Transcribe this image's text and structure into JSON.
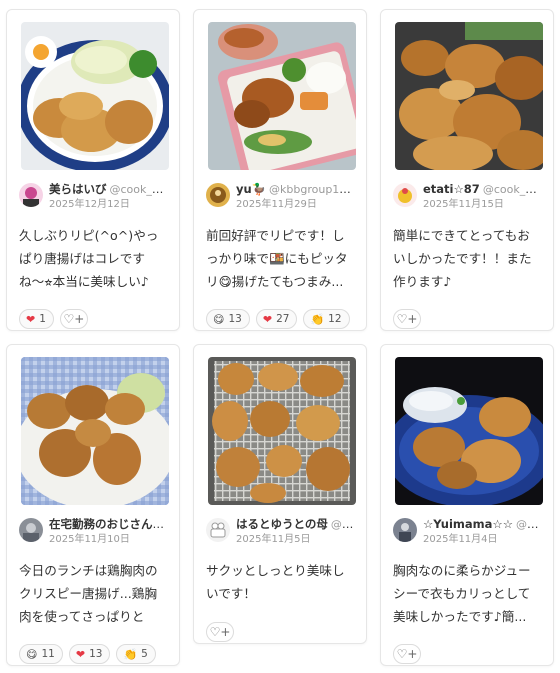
{
  "cards": [
    {
      "author_name": "美らはいび",
      "author_handle": "@cook_4...",
      "date": "2025年12月12日",
      "comment": "久しぶりリピ(^o^)やっぱり唐揚げはコレですね〜⭐︎本当に美味しい♪",
      "reactions": [
        {
          "icon": "heart-icon",
          "glyph": "❤",
          "count": "1"
        }
      ],
      "add_reaction_icon": "add-reaction-icon"
    },
    {
      "author_name": "yu🦆",
      "author_handle": "@kbbgroup1975",
      "date": "2025年11月29日",
      "comment": "前回好評でリピです！しっかり味で🍱にもピッタリ😋揚げたてもつまみ...",
      "reactions": [
        {
          "icon": "yum-face-icon",
          "glyph": "😋",
          "count": "13"
        },
        {
          "icon": "heart-icon",
          "glyph": "❤",
          "count": "27"
        },
        {
          "icon": "clap-icon",
          "glyph": "👏",
          "count": "12"
        }
      ]
    },
    {
      "author_name": "etati☆87",
      "author_handle": "@cook_40...",
      "date": "2025年11月15日",
      "comment": "簡単にできてとってもおいしかったです！！また作ります♪",
      "reactions": [],
      "add_reaction_icon": "add-reaction-icon"
    },
    {
      "author_name": "在宅勤務のおじさん ...",
      "author_handle": "",
      "date": "2025年11月10日",
      "comment": "今日のランチは鶏胸肉のクリスピー唐揚げ...鶏胸肉を使ってさっぱりとし...",
      "reactions": [
        {
          "icon": "yum-face-icon",
          "glyph": "😋",
          "count": "11"
        },
        {
          "icon": "heart-icon",
          "glyph": "❤",
          "count": "13"
        },
        {
          "icon": "clap-icon",
          "glyph": "👏",
          "count": "5"
        }
      ]
    },
    {
      "author_name": "はるとゆうとの母",
      "author_handle": "@c...",
      "date": "2025年11月5日",
      "comment": "サクッとしっとり美味しいです！",
      "reactions": [],
      "add_reaction_icon": "add-reaction-icon"
    },
    {
      "author_name": "☆Yuimama☆☆",
      "author_handle": "@c...",
      "date": "2025年11月4日",
      "comment": "胸肉なのに柔らかジューシーで衣もカリっとして美味しかったです♪簡...",
      "reactions": [],
      "add_reaction_icon": "add-reaction-icon"
    }
  ],
  "add_reaction_glyph": "♡+",
  "colors": {
    "heart": "#e53945",
    "border": "#e6e6e6",
    "muted": "#9a9a9a"
  }
}
